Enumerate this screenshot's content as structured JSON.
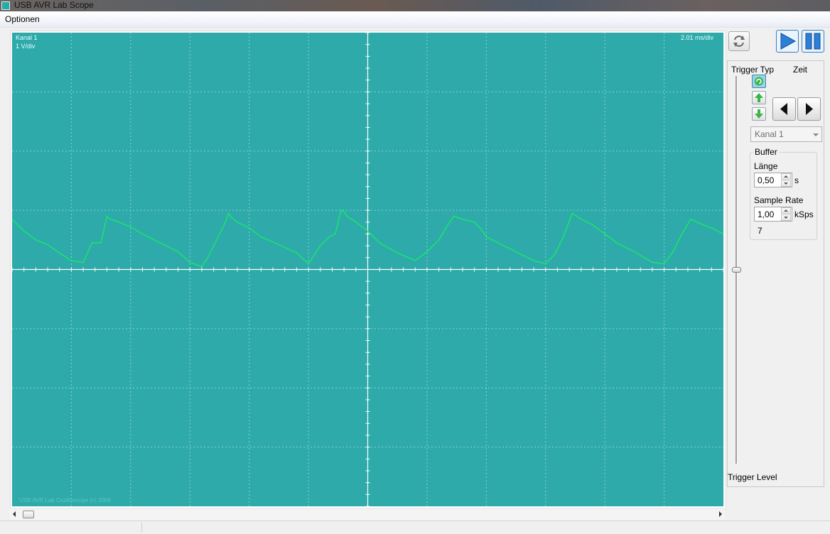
{
  "window": {
    "title": "USB AVR Lab Scope",
    "icon": "scope-app-icon"
  },
  "menu": {
    "items": [
      "Optionen"
    ]
  },
  "scope": {
    "channel_label": "Kanal 1",
    "volts_per_div": "1 V/div",
    "time_per_div": "2.01 ms/div",
    "watermark": "USB AVR Lab Oszilloscope (c) 2008",
    "background_color": "#2eaaaa",
    "trace_color": "#19e66a",
    "grid_color": "#86d0d0"
  },
  "chart_data": {
    "type": "line",
    "title": "",
    "xlabel": "",
    "ylabel": "",
    "x_divisions": 12,
    "y_divisions": 8,
    "xlim": [
      0,
      12
    ],
    "ylim": [
      -4,
      4
    ],
    "grid": true,
    "series": [
      {
        "name": "Kanal 1",
        "x": [
          0,
          0.1,
          0.2,
          0.4,
          0.6,
          0.8,
          1.0,
          1.2,
          1.35,
          1.5,
          1.6,
          1.65,
          1.75,
          1.8,
          2.0,
          2.2,
          2.5,
          2.8,
          3.0,
          3.2,
          3.3,
          3.45,
          3.6,
          3.65,
          3.7,
          3.8,
          4.0,
          4.2,
          4.5,
          4.8,
          5.0,
          5.2,
          5.35,
          5.45,
          5.55,
          5.6,
          5.65,
          5.8,
          6.0,
          6.2,
          6.5,
          6.8,
          7.0,
          7.2,
          7.35,
          7.45,
          7.6,
          7.8,
          7.9,
          8.0,
          8.2,
          8.5,
          8.8,
          9.0,
          9.15,
          9.3,
          9.45,
          9.6,
          9.8,
          10.0,
          10.2,
          10.5,
          10.8,
          11.0,
          11.15,
          11.3,
          11.45,
          11.6,
          11.8,
          12.0
        ],
        "y": [
          0.85,
          0.75,
          0.65,
          0.5,
          0.42,
          0.28,
          0.15,
          0.12,
          0.45,
          0.45,
          0.9,
          0.85,
          0.82,
          0.8,
          0.72,
          0.6,
          0.45,
          0.3,
          0.12,
          0.05,
          0.2,
          0.5,
          0.8,
          0.95,
          0.88,
          0.8,
          0.7,
          0.55,
          0.42,
          0.28,
          0.1,
          0.4,
          0.55,
          0.6,
          1.0,
          0.98,
          0.9,
          0.8,
          0.65,
          0.45,
          0.28,
          0.15,
          0.3,
          0.5,
          0.75,
          0.9,
          0.85,
          0.8,
          0.7,
          0.55,
          0.45,
          0.3,
          0.15,
          0.1,
          0.25,
          0.55,
          0.95,
          0.85,
          0.75,
          0.6,
          0.45,
          0.3,
          0.12,
          0.1,
          0.3,
          0.6,
          0.85,
          0.78,
          0.7,
          0.6
        ]
      }
    ]
  },
  "controls": {
    "trigger_typ_label": "Trigger Typ",
    "zeit_label": "Zeit",
    "trigger_level_label": "Trigger Level",
    "channel_select_value": "Kanal 1",
    "buffer": {
      "title": "Buffer",
      "laenge_label": "Länge",
      "laenge_value": "0,50",
      "laenge_unit": "s",
      "sample_rate_label": "Sample Rate",
      "sample_rate_value": "1,00",
      "sample_rate_unit": "kSps",
      "count": "7"
    },
    "trigger_level": 0.0,
    "play_color": "#2a7fd9",
    "pause_color": "#2a7fd9"
  },
  "icons": [
    "refresh-icon",
    "play-icon",
    "pause-icon",
    "trigger-auto-icon",
    "trigger-rising-icon",
    "trigger-falling-icon",
    "arrow-left-icon",
    "arrow-right-icon"
  ]
}
